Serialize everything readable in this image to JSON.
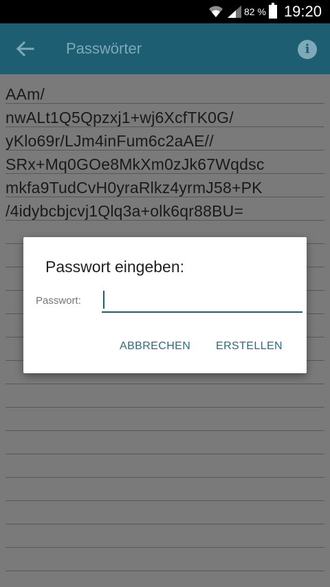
{
  "status_bar": {
    "battery_percent": "82 %",
    "time": "19:20"
  },
  "app_bar": {
    "title": "Passwörter",
    "back_icon": "arrow-left",
    "info_icon": "info"
  },
  "note": {
    "text": "AAm/\nnwALt1Q5Qpzxj1+wj6XcfTK0G/\nyKlo69r/LJm4inFum6c2aAE//\nSRx+Mq0GOe8MkXm0zJk67Wqdsc\nmkfa9TudCvH0yraRlkz4yrmJ58+PK\n/4idybcbjcvj1Qlq3a+olk6qr88BU="
  },
  "dialog": {
    "title": "Passwort eingeben:",
    "password_label": "Passwort:",
    "password_value": "",
    "cancel_label": "ABBRECHEN",
    "create_label": "ERSTELLEN"
  },
  "colors": {
    "app_bar": "#1d5e73",
    "accent": "#2c6b80"
  }
}
